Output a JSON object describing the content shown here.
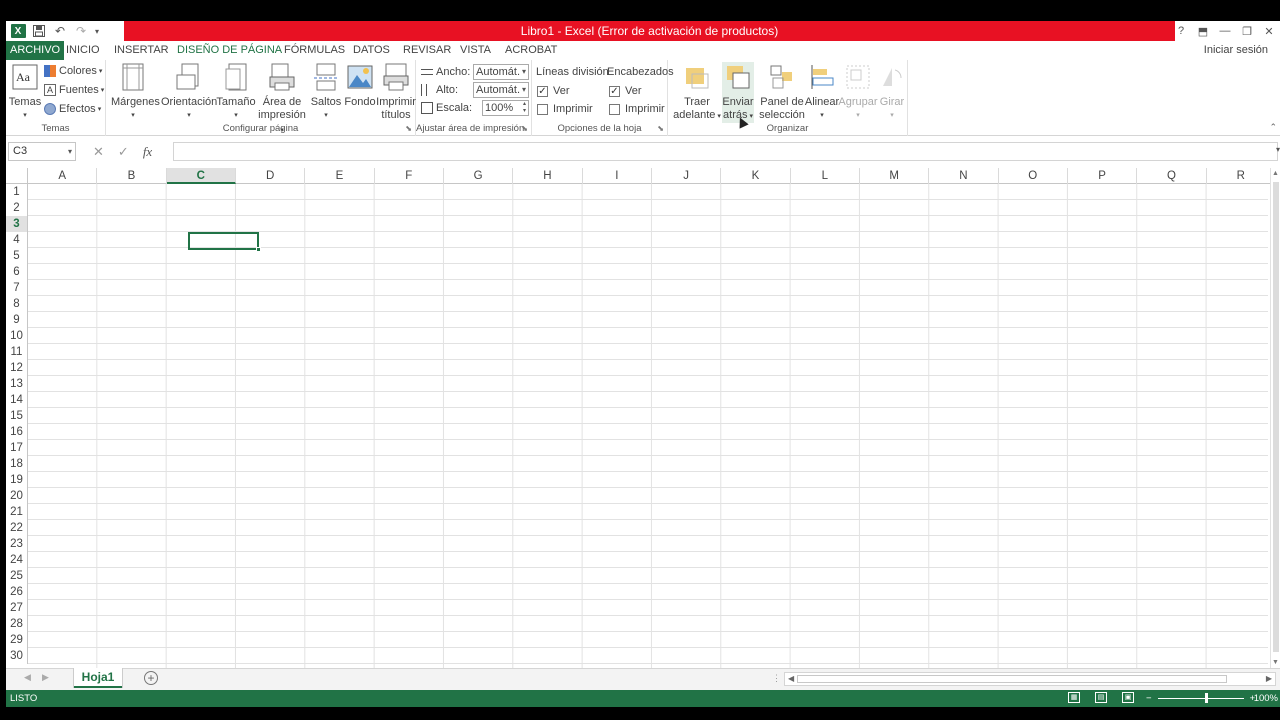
{
  "window": {
    "title": "Libro1 -  Excel (Error de activación de productos)",
    "help_icon": "?",
    "signin": "Iniciar sesión"
  },
  "colors": {
    "excel_green": "#217346",
    "title_red": "#e81123"
  },
  "tabs": [
    "ARCHIVO",
    "INICIO",
    "INSERTAR",
    "DISEÑO DE PÁGINA",
    "FÓRMULAS",
    "DATOS",
    "REVISAR",
    "VISTA",
    "ACROBAT"
  ],
  "active_tab": "DISEÑO DE PÁGINA",
  "ribbon": {
    "temas": {
      "label": "Temas",
      "group": "Temas",
      "colores": "Colores",
      "fuentes": "Fuentes",
      "efectos": "Efectos"
    },
    "configurar": {
      "group": "Configurar página",
      "margenes": "Márgenes",
      "orientacion": "Orientación",
      "tamano": "Tamaño",
      "area_1": "Área de",
      "area_2": "impresión",
      "saltos": "Saltos",
      "fondo": "Fondo",
      "imprimir_1": "Imprimir",
      "imprimir_2": "títulos"
    },
    "ajustar": {
      "group": "Ajustar área de impresión",
      "ancho_label": "Ancho:",
      "ancho_value": "Automát.",
      "alto_label": "Alto:",
      "alto_value": "Automát.",
      "escala_label": "Escala:",
      "escala_value": "100%"
    },
    "opciones": {
      "group": "Opciones de la hoja",
      "lineas": "Líneas división",
      "encabezados": "Encabezados",
      "ver": "Ver",
      "imprimir": "Imprimir",
      "lineas_ver_checked": true,
      "lineas_imprimir_checked": false,
      "enc_ver_checked": true,
      "enc_imprimir_checked": false
    },
    "organizar": {
      "group": "Organizar",
      "traer_1": "Traer",
      "traer_2": "adelante",
      "enviar_1": "Enviar",
      "enviar_2": "atrás",
      "panel_1": "Panel de",
      "panel_2": "selección",
      "alinear": "Alinear",
      "agrupar": "Agrupar",
      "girar": "Girar"
    }
  },
  "formula_bar": {
    "name_box": "C3",
    "fx": "fx",
    "cancel": "✕",
    "enter": "✓",
    "value": ""
  },
  "columns": [
    "A",
    "B",
    "C",
    "D",
    "E",
    "F",
    "G",
    "H",
    "I",
    "J",
    "K",
    "L",
    "M",
    "N",
    "O",
    "P",
    "Q",
    "R"
  ],
  "rows": [
    "1",
    "2",
    "3",
    "4",
    "5",
    "6",
    "7",
    "8",
    "9",
    "10",
    "11",
    "12",
    "13",
    "14",
    "15",
    "16",
    "17",
    "18",
    "19",
    "20",
    "21",
    "22",
    "23",
    "24",
    "25",
    "26",
    "27",
    "28",
    "29",
    "30"
  ],
  "selected_cell": {
    "col": "C",
    "row": "3"
  },
  "sheets": [
    "Hoja1"
  ],
  "add_sheet": "+",
  "status": {
    "text": "LISTO",
    "zoom": "100%"
  }
}
